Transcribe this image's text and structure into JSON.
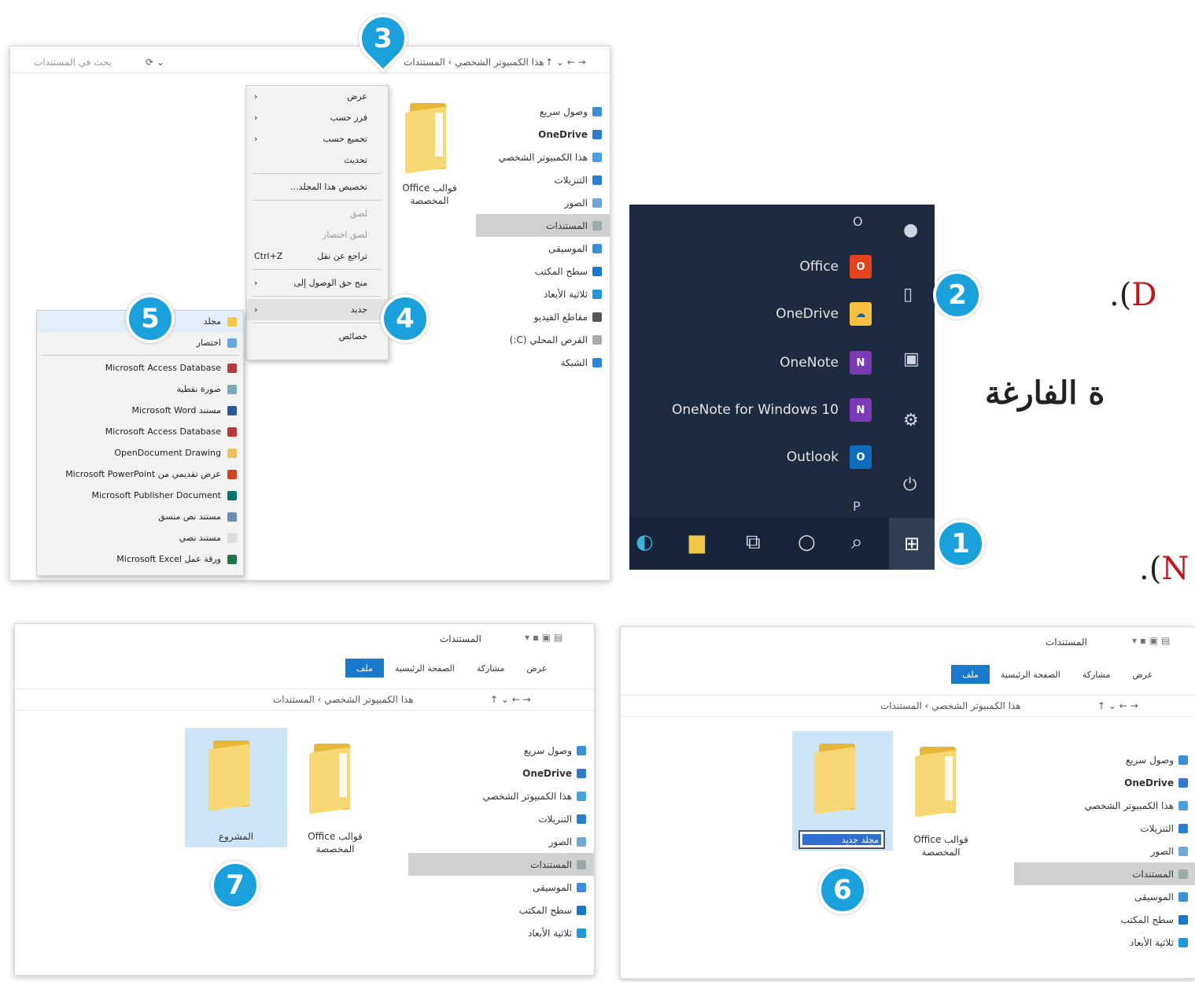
{
  "colors": {
    "accent": "#1aa0db",
    "red_text": "#c0161b",
    "start_bg": "#1d2a3f"
  },
  "callouts": [
    "1",
    "2",
    "3",
    "4",
    "5",
    "6",
    "7"
  ],
  "right_text": {
    "line1_paren_open": ".(",
    "line1_red": "D",
    "line2": "ة الفارغة",
    "line3_paren_open": ".(",
    "line3_red": "N"
  },
  "explorer_top": {
    "search_placeholder": "بحث في المستندات",
    "address": "هذا الكمبيوتر الشخصي › المستندات",
    "nav": [
      "وصول سريع",
      "OneDrive",
      "هذا الكمبيوتر الشخصي",
      "التنزيلات",
      "الصور",
      "المستندات",
      "الموسيقى",
      "سطح المكتب",
      "ثلاثية الأبعاد",
      "مقاطع الفيديو",
      "القرص المحلي (C:)",
      "الشبكة"
    ],
    "folder_label": "قوالب Office المخصصة",
    "context_menu": [
      "عرض",
      "فرز حسب",
      "تجميع حسب",
      "تحديث",
      "تخصيص هذا المجلد...",
      "لصق",
      "لصق اختصار",
      "تراجع عن نقل",
      "منح حق الوصول إلى",
      "جديد",
      "خصائص"
    ],
    "undo_shortcut": "Ctrl+Z",
    "submenu": [
      "مجلد",
      "اختصار",
      "Microsoft Access Database",
      "صورة نقطية",
      "مستند Microsoft Word",
      "Microsoft Access Database",
      "OpenDocument Drawing",
      "عرض تقديمي من Microsoft PowerPoint",
      "Microsoft Publisher Document",
      "مستند نص منسق",
      "مستند نصي",
      "ورقة عمل Microsoft Excel"
    ]
  },
  "start_menu": {
    "letter_o": "O",
    "letter_p": "P",
    "apps": [
      "Office",
      "OneDrive",
      "OneNote",
      "OneNote for Windows 10",
      "Outlook"
    ],
    "app_icons": {
      "Office": "office-icon",
      "OneDrive": "onedrive-icon",
      "OneNote": "onenote-icon",
      "Outlook": "outlook-icon"
    }
  },
  "explorer_bl": {
    "title": "المستندات",
    "tabs": [
      "ملف",
      "الصفحة الرئيسية",
      "مشاركة",
      "عرض"
    ],
    "address": "هذا الكمبيوتر الشخصي › المستندات",
    "nav": [
      "وصول سريع",
      "OneDrive",
      "هذا الكمبيوتر الشخصي",
      "التنزيلات",
      "الصور",
      "المستندات",
      "الموسيقى",
      "سطح المكتب",
      "ثلاثية الأبعاد"
    ],
    "folder1": "قوالب Office المخصصة",
    "folder2": "المشروع"
  },
  "explorer_br": {
    "title": "المستندات",
    "tabs": [
      "ملف",
      "الصفحة الرئيسية",
      "مشاركة",
      "عرض"
    ],
    "address": "هذا الكمبيوتر الشخصي › المستندات",
    "nav": [
      "وصول سريع",
      "OneDrive",
      "هذا الكمبيوتر الشخصي",
      "التنزيلات",
      "الصور",
      "المستندات",
      "الموسيقى",
      "سطح المكتب",
      "ثلاثية الأبعاد"
    ],
    "folder1": "قوالب Office المخصصة",
    "rename_value": "مجلد جديد"
  }
}
